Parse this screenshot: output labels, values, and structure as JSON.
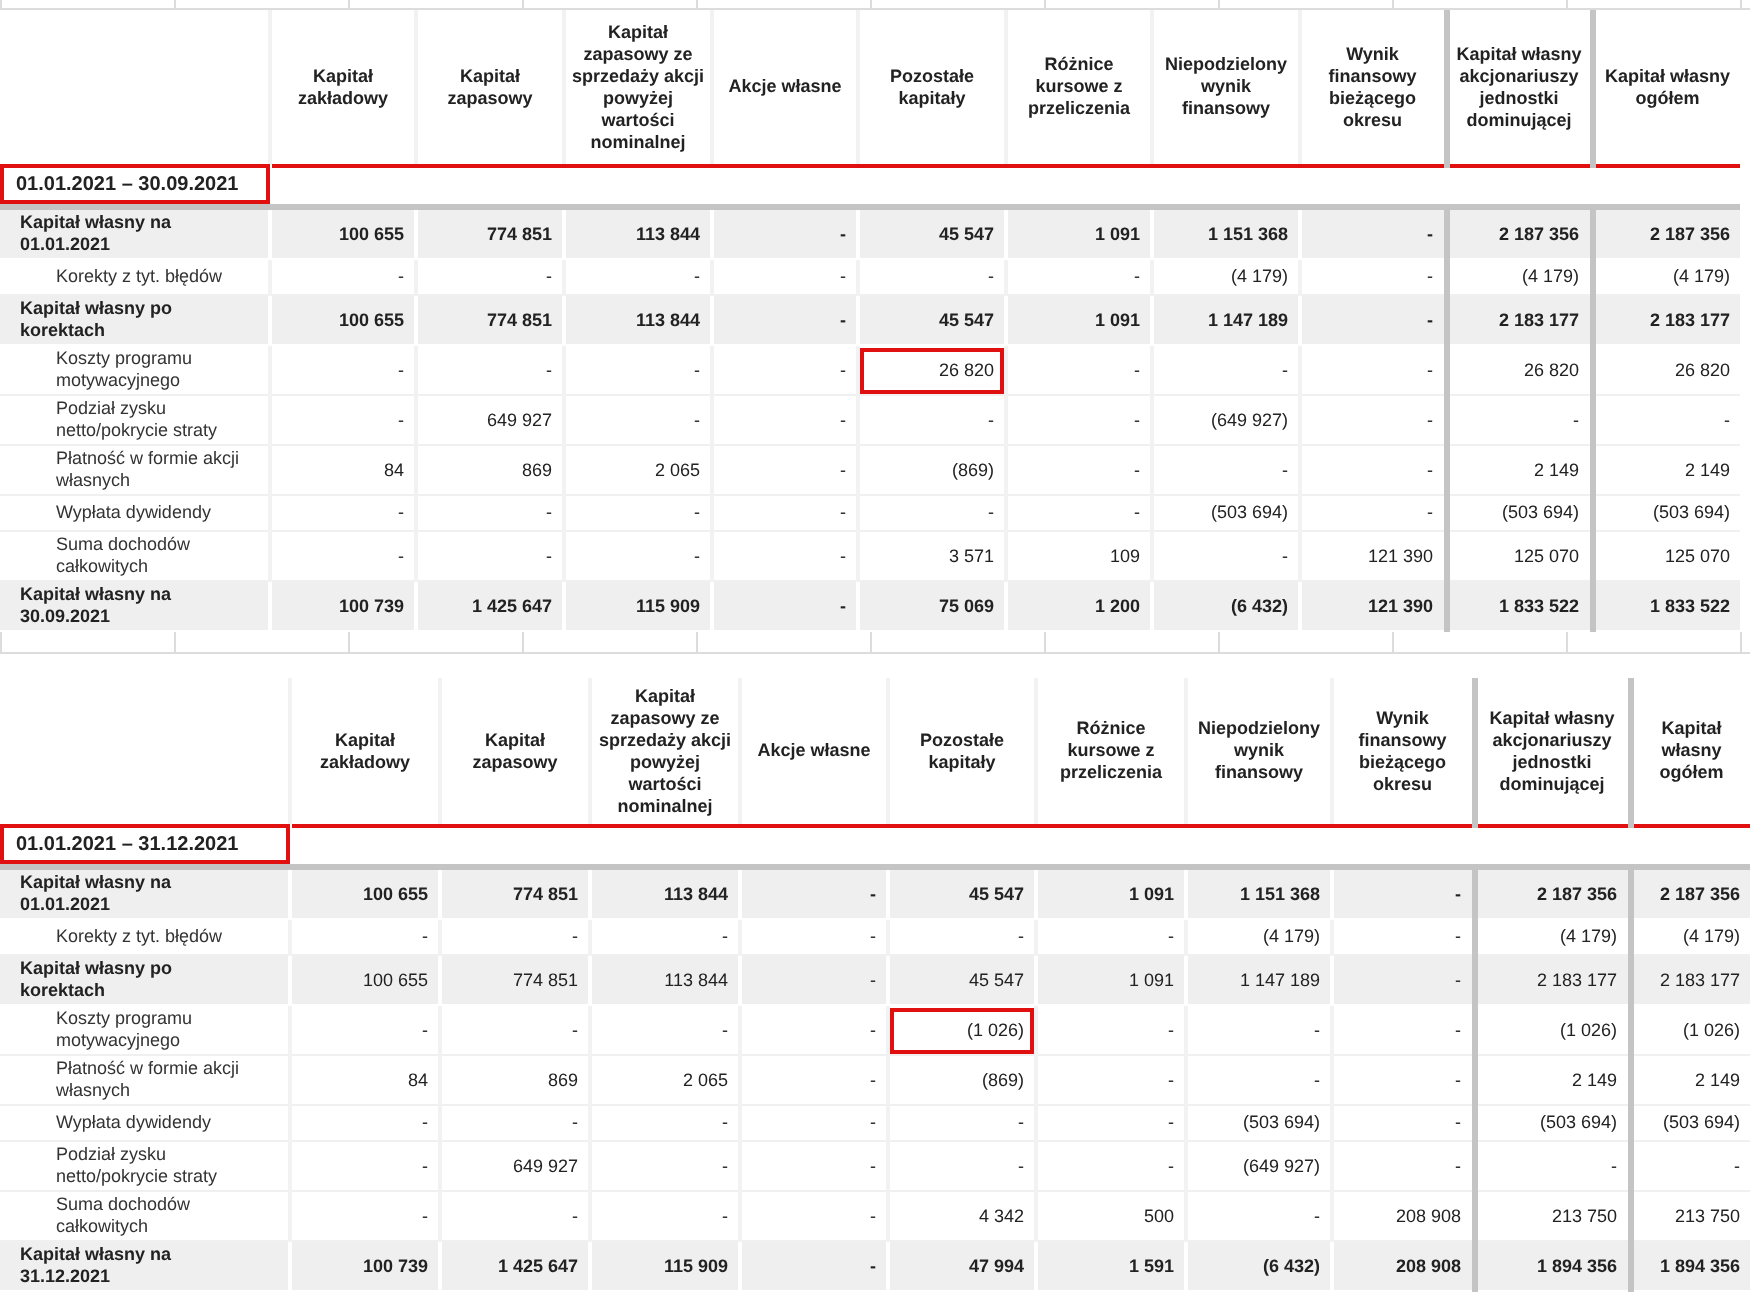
{
  "tables": [
    {
      "period": "01.01.2021 – 30.09.2021",
      "columns": [
        "Kapitał zakładowy",
        "Kapitał zapasowy",
        "Kapitał zapasowy ze sprzedaży akcji powyżej wartości nominalnej",
        "Akcje własne",
        "Pozostałe kapitały",
        "Różnice kursowe z przeliczenia",
        "Niepodzielony wynik finansowy",
        "Wynik finansowy bieżącego okresu",
        "Kapitał własny akcjonariuszy jednostki dominującej",
        "Kapitał własny ogółem"
      ],
      "rows": [
        {
          "kind": "total",
          "label": "Kapitał własny na 01.01.2021",
          "values_bold": true,
          "cells": [
            {
              "text": "100 655",
              "highlighted": false
            },
            {
              "text": "774 851",
              "highlighted": false
            },
            {
              "text": "113 844",
              "highlighted": false
            },
            {
              "text": "-",
              "highlighted": false
            },
            {
              "text": "45 547",
              "highlighted": false
            },
            {
              "text": "1 091",
              "highlighted": false
            },
            {
              "text": "1 151 368",
              "highlighted": false
            },
            {
              "text": "-",
              "highlighted": false
            },
            {
              "text": "2 187 356",
              "highlighted": false
            },
            {
              "text": "2 187 356",
              "highlighted": false
            }
          ]
        },
        {
          "kind": "detail",
          "label": "Korekty z tyt. błędów",
          "values_bold": false,
          "cells": [
            {
              "text": "-",
              "highlighted": false
            },
            {
              "text": "-",
              "highlighted": false
            },
            {
              "text": "-",
              "highlighted": false
            },
            {
              "text": "-",
              "highlighted": false
            },
            {
              "text": "-",
              "highlighted": false
            },
            {
              "text": "-",
              "highlighted": false
            },
            {
              "text": "(4 179)",
              "highlighted": false
            },
            {
              "text": "-",
              "highlighted": false
            },
            {
              "text": "(4 179)",
              "highlighted": false
            },
            {
              "text": "(4 179)",
              "highlighted": false
            }
          ]
        },
        {
          "kind": "total",
          "label": "Kapitał własny po korektach",
          "values_bold": true,
          "cells": [
            {
              "text": "100 655",
              "highlighted": false
            },
            {
              "text": "774 851",
              "highlighted": false
            },
            {
              "text": "113 844",
              "highlighted": false
            },
            {
              "text": "-",
              "highlighted": false
            },
            {
              "text": "45 547",
              "highlighted": false
            },
            {
              "text": "1 091",
              "highlighted": false
            },
            {
              "text": "1 147 189",
              "highlighted": false
            },
            {
              "text": "-",
              "highlighted": false
            },
            {
              "text": "2 183 177",
              "highlighted": false
            },
            {
              "text": "2 183 177",
              "highlighted": false
            }
          ]
        },
        {
          "kind": "detail",
          "label": "Koszty programu motywacyjnego",
          "values_bold": false,
          "cells": [
            {
              "text": "-",
              "highlighted": false
            },
            {
              "text": "-",
              "highlighted": false
            },
            {
              "text": "-",
              "highlighted": false
            },
            {
              "text": "-",
              "highlighted": false
            },
            {
              "text": "26 820",
              "highlighted": true
            },
            {
              "text": "-",
              "highlighted": false
            },
            {
              "text": "-",
              "highlighted": false
            },
            {
              "text": "-",
              "highlighted": false
            },
            {
              "text": "26 820",
              "highlighted": false
            },
            {
              "text": "26 820",
              "highlighted": false
            }
          ]
        },
        {
          "kind": "detail",
          "label": "Podział zysku netto/pokrycie straty",
          "values_bold": false,
          "cells": [
            {
              "text": "-",
              "highlighted": false
            },
            {
              "text": "649 927",
              "highlighted": false
            },
            {
              "text": "-",
              "highlighted": false
            },
            {
              "text": "-",
              "highlighted": false
            },
            {
              "text": "-",
              "highlighted": false
            },
            {
              "text": "-",
              "highlighted": false
            },
            {
              "text": "(649 927)",
              "highlighted": false
            },
            {
              "text": "-",
              "highlighted": false
            },
            {
              "text": "-",
              "highlighted": false
            },
            {
              "text": "-",
              "highlighted": false
            }
          ]
        },
        {
          "kind": "detail",
          "label": "Płatność w formie akcji własnych",
          "values_bold": false,
          "cells": [
            {
              "text": "84",
              "highlighted": false
            },
            {
              "text": "869",
              "highlighted": false
            },
            {
              "text": "2 065",
              "highlighted": false
            },
            {
              "text": "-",
              "highlighted": false
            },
            {
              "text": "(869)",
              "highlighted": false
            },
            {
              "text": "-",
              "highlighted": false
            },
            {
              "text": "-",
              "highlighted": false
            },
            {
              "text": "-",
              "highlighted": false
            },
            {
              "text": "2 149",
              "highlighted": false
            },
            {
              "text": "2 149",
              "highlighted": false
            }
          ]
        },
        {
          "kind": "detail",
          "label": "Wypłata dywidendy",
          "values_bold": false,
          "cells": [
            {
              "text": "-",
              "highlighted": false
            },
            {
              "text": "-",
              "highlighted": false
            },
            {
              "text": "-",
              "highlighted": false
            },
            {
              "text": "-",
              "highlighted": false
            },
            {
              "text": "-",
              "highlighted": false
            },
            {
              "text": "-",
              "highlighted": false
            },
            {
              "text": "(503 694)",
              "highlighted": false
            },
            {
              "text": "-",
              "highlighted": false
            },
            {
              "text": "(503 694)",
              "highlighted": false
            },
            {
              "text": "(503 694)",
              "highlighted": false
            }
          ]
        },
        {
          "kind": "detail",
          "label": "Suma dochodów całkowitych",
          "values_bold": false,
          "cells": [
            {
              "text": "-",
              "highlighted": false
            },
            {
              "text": "-",
              "highlighted": false
            },
            {
              "text": "-",
              "highlighted": false
            },
            {
              "text": "-",
              "highlighted": false
            },
            {
              "text": "3 571",
              "highlighted": false
            },
            {
              "text": "109",
              "highlighted": false
            },
            {
              "text": "-",
              "highlighted": false
            },
            {
              "text": "121 390",
              "highlighted": false
            },
            {
              "text": "125 070",
              "highlighted": false
            },
            {
              "text": "125 070",
              "highlighted": false
            }
          ]
        },
        {
          "kind": "total",
          "label": "Kapitał własny na 30.09.2021",
          "values_bold": true,
          "cells": [
            {
              "text": "100 739",
              "highlighted": false
            },
            {
              "text": "1 425 647",
              "highlighted": false
            },
            {
              "text": "115 909",
              "highlighted": false
            },
            {
              "text": "-",
              "highlighted": false
            },
            {
              "text": "75 069",
              "highlighted": false
            },
            {
              "text": "1 200",
              "highlighted": false
            },
            {
              "text": "(6 432)",
              "highlighted": false
            },
            {
              "text": "121 390",
              "highlighted": false
            },
            {
              "text": "1 833 522",
              "highlighted": false
            },
            {
              "text": "1 833 522",
              "highlighted": false
            }
          ]
        }
      ]
    },
    {
      "period": "01.01.2021 – 31.12.2021",
      "columns": [
        "Kapitał zakładowy",
        "Kapitał zapasowy",
        "Kapitał zapasowy ze sprzedaży akcji powyżej wartości nominalnej",
        "Akcje własne",
        "Pozostałe kapitały",
        "Różnice kursowe z przeliczenia",
        "Niepodzielony wynik finansowy",
        "Wynik finansowy bieżącego okresu",
        "Kapitał własny akcjonariuszy jednostki dominującej",
        "Kapitał własny ogółem"
      ],
      "rows": [
        {
          "kind": "total",
          "label": "Kapitał własny na 01.01.2021",
          "values_bold": true,
          "cells": [
            {
              "text": "100 655",
              "highlighted": false
            },
            {
              "text": "774 851",
              "highlighted": false
            },
            {
              "text": "113 844",
              "highlighted": false
            },
            {
              "text": "-",
              "highlighted": false
            },
            {
              "text": "45 547",
              "highlighted": false
            },
            {
              "text": "1 091",
              "highlighted": false
            },
            {
              "text": "1 151 368",
              "highlighted": false
            },
            {
              "text": "-",
              "highlighted": false
            },
            {
              "text": "2 187 356",
              "highlighted": false
            },
            {
              "text": "2 187 356",
              "highlighted": false
            }
          ]
        },
        {
          "kind": "detail",
          "label": "Korekty z tyt. błędów",
          "values_bold": false,
          "cells": [
            {
              "text": "-",
              "highlighted": false
            },
            {
              "text": "-",
              "highlighted": false
            },
            {
              "text": "-",
              "highlighted": false
            },
            {
              "text": "-",
              "highlighted": false
            },
            {
              "text": "-",
              "highlighted": false
            },
            {
              "text": "-",
              "highlighted": false
            },
            {
              "text": "(4 179)",
              "highlighted": false
            },
            {
              "text": "-",
              "highlighted": false
            },
            {
              "text": "(4 179)",
              "highlighted": false
            },
            {
              "text": "(4 179)",
              "highlighted": false
            }
          ]
        },
        {
          "kind": "total",
          "label": "Kapitał własny po korektach",
          "values_bold": false,
          "cells": [
            {
              "text": "100 655",
              "highlighted": false
            },
            {
              "text": "774 851",
              "highlighted": false
            },
            {
              "text": "113 844",
              "highlighted": false
            },
            {
              "text": "-",
              "highlighted": false
            },
            {
              "text": "45 547",
              "highlighted": false
            },
            {
              "text": "1 091",
              "highlighted": false
            },
            {
              "text": "1 147 189",
              "highlighted": false
            },
            {
              "text": "-",
              "highlighted": false
            },
            {
              "text": "2 183 177",
              "highlighted": false
            },
            {
              "text": "2 183 177",
              "highlighted": false
            }
          ]
        },
        {
          "kind": "detail",
          "label": "Koszty programu motywacyjnego",
          "values_bold": false,
          "cells": [
            {
              "text": "-",
              "highlighted": false
            },
            {
              "text": "-",
              "highlighted": false
            },
            {
              "text": "-",
              "highlighted": false
            },
            {
              "text": "-",
              "highlighted": false
            },
            {
              "text": "(1 026)",
              "highlighted": true
            },
            {
              "text": "-",
              "highlighted": false
            },
            {
              "text": "-",
              "highlighted": false
            },
            {
              "text": "-",
              "highlighted": false
            },
            {
              "text": "(1 026)",
              "highlighted": false
            },
            {
              "text": "(1 026)",
              "highlighted": false
            }
          ]
        },
        {
          "kind": "detail",
          "label": "Płatność w formie akcji własnych",
          "values_bold": false,
          "cells": [
            {
              "text": "84",
              "highlighted": false
            },
            {
              "text": "869",
              "highlighted": false
            },
            {
              "text": "2 065",
              "highlighted": false
            },
            {
              "text": "-",
              "highlighted": false
            },
            {
              "text": "(869)",
              "highlighted": false
            },
            {
              "text": "-",
              "highlighted": false
            },
            {
              "text": "-",
              "highlighted": false
            },
            {
              "text": "-",
              "highlighted": false
            },
            {
              "text": "2 149",
              "highlighted": false
            },
            {
              "text": "2 149",
              "highlighted": false
            }
          ]
        },
        {
          "kind": "detail",
          "label": "Wypłata dywidendy",
          "values_bold": false,
          "cells": [
            {
              "text": "-",
              "highlighted": false
            },
            {
              "text": "-",
              "highlighted": false
            },
            {
              "text": "-",
              "highlighted": false
            },
            {
              "text": "-",
              "highlighted": false
            },
            {
              "text": "-",
              "highlighted": false
            },
            {
              "text": "-",
              "highlighted": false
            },
            {
              "text": "(503 694)",
              "highlighted": false
            },
            {
              "text": "-",
              "highlighted": false
            },
            {
              "text": "(503 694)",
              "highlighted": false
            },
            {
              "text": "(503 694)",
              "highlighted": false
            }
          ]
        },
        {
          "kind": "detail",
          "label": "Podział zysku netto/pokrycie straty",
          "values_bold": false,
          "cells": [
            {
              "text": "-",
              "highlighted": false
            },
            {
              "text": "649 927",
              "highlighted": false
            },
            {
              "text": "-",
              "highlighted": false
            },
            {
              "text": "-",
              "highlighted": false
            },
            {
              "text": "-",
              "highlighted": false
            },
            {
              "text": "-",
              "highlighted": false
            },
            {
              "text": "(649 927)",
              "highlighted": false
            },
            {
              "text": "-",
              "highlighted": false
            },
            {
              "text": "-",
              "highlighted": false
            },
            {
              "text": "-",
              "highlighted": false
            }
          ]
        },
        {
          "kind": "detail",
          "label": "Suma dochodów całkowitych",
          "values_bold": false,
          "cells": [
            {
              "text": "-",
              "highlighted": false
            },
            {
              "text": "-",
              "highlighted": false
            },
            {
              "text": "-",
              "highlighted": false
            },
            {
              "text": "-",
              "highlighted": false
            },
            {
              "text": "4 342",
              "highlighted": false
            },
            {
              "text": "500",
              "highlighted": false
            },
            {
              "text": "-",
              "highlighted": false
            },
            {
              "text": "208 908",
              "highlighted": false
            },
            {
              "text": "213 750",
              "highlighted": false
            },
            {
              "text": "213 750",
              "highlighted": false
            }
          ]
        },
        {
          "kind": "total",
          "label": "Kapitał własny na 31.12.2021",
          "values_bold": true,
          "cells": [
            {
              "text": "100 739",
              "highlighted": false
            },
            {
              "text": "1 425 647",
              "highlighted": false
            },
            {
              "text": "115 909",
              "highlighted": false
            },
            {
              "text": "-",
              "highlighted": false
            },
            {
              "text": "47 994",
              "highlighted": false
            },
            {
              "text": "1 591",
              "highlighted": false
            },
            {
              "text": "(6 432)",
              "highlighted": false
            },
            {
              "text": "208 908",
              "highlighted": false
            },
            {
              "text": "1 894 356",
              "highlighted": false
            },
            {
              "text": "1 894 356",
              "highlighted": false
            }
          ]
        }
      ]
    }
  ]
}
